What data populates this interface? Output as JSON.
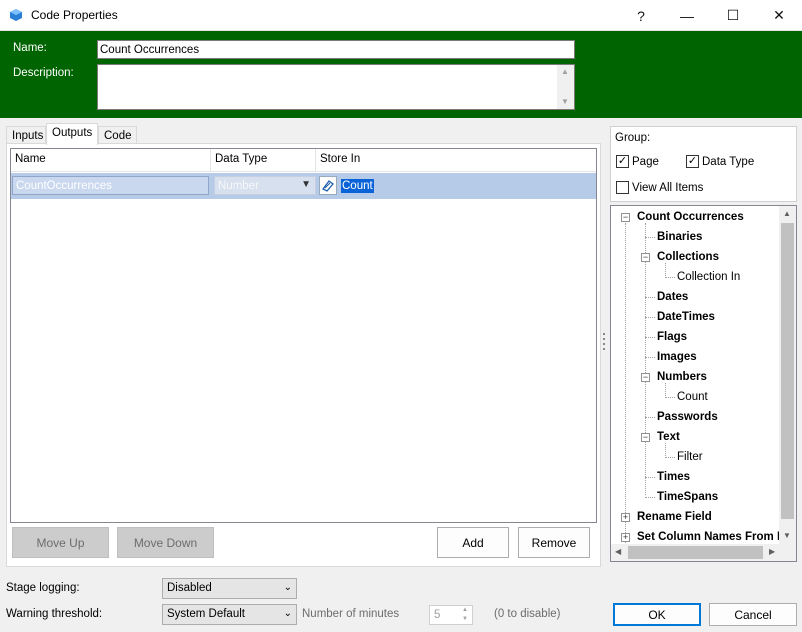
{
  "window": {
    "title": "Code Properties",
    "help": "?",
    "minimize": "—",
    "maximize": "☐",
    "close": "✕"
  },
  "header": {
    "name_label": "Name:",
    "name_value": "Count Occurrences",
    "description_label": "Description:",
    "description_value": "",
    "background_color": "#006400"
  },
  "tabs": [
    "Inputs",
    "Outputs",
    "Code"
  ],
  "active_tab": "Outputs",
  "grid": {
    "columns": [
      "Name",
      "Data Type",
      "Store In"
    ],
    "rows": [
      {
        "name": "CountOccurrences",
        "data_type": "Number",
        "store_in": "Count"
      }
    ]
  },
  "buttons": {
    "move_up": "Move Up",
    "move_down": "Move Down",
    "add": "Add",
    "remove": "Remove",
    "ok": "OK",
    "cancel": "Cancel"
  },
  "group": {
    "title": "Group:",
    "page": {
      "label": "Page",
      "checked": true
    },
    "data_type": {
      "label": "Data Type",
      "checked": true
    },
    "view_all": {
      "label": "View All Items",
      "checked": false
    }
  },
  "tree": {
    "root": "Count Occurrences",
    "items": {
      "binaries": "Binaries",
      "collections": "Collections",
      "collection_in": "Collection In",
      "dates": "Dates",
      "datetimes": "DateTimes",
      "flags": "Flags",
      "images": "Images",
      "numbers": "Numbers",
      "count": "Count",
      "passwords": "Passwords",
      "text": "Text",
      "filter": "Filter",
      "times": "Times",
      "timespans": "TimeSpans"
    },
    "rename_field": "Rename Field",
    "set_column_names": "Set Column Names From E"
  },
  "footer": {
    "stage_logging_label": "Stage logging:",
    "stage_logging_value": "Disabled",
    "warning_threshold_label": "Warning threshold:",
    "warning_threshold_value": "System Default",
    "minutes_label": "Number of minutes",
    "minutes_value": "5",
    "minutes_hint": "(0 to disable)"
  },
  "colors": {
    "selection": "#0a64d8",
    "row_highlight": "#b6cbe8",
    "ok_border": "#0078d7"
  }
}
